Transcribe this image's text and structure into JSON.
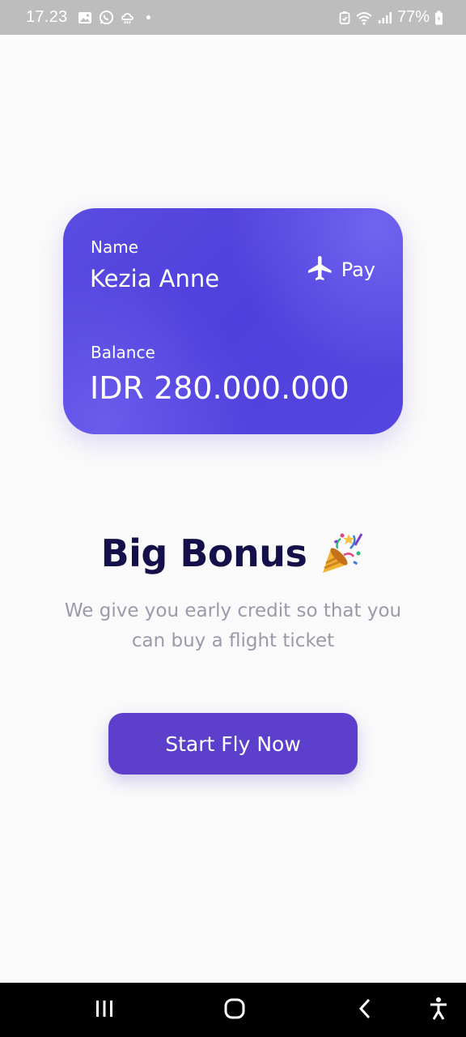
{
  "status_bar": {
    "time": "17.23",
    "battery": "77%",
    "left_icons": [
      "image-icon",
      "whatsapp-icon",
      "weather-icon"
    ],
    "right_icons": [
      "vpn-icon",
      "wifi-icon",
      "signal-icon",
      "battery-icon"
    ]
  },
  "card": {
    "name_label": "Name",
    "name_value": "Kezia Anne",
    "brand_label": "Pay",
    "brand_icon": "airplane-icon",
    "balance_label": "Balance",
    "balance_value": "IDR 280.000.000",
    "gradient_colors": [
      "#5A4BE0",
      "#4F3FDC",
      "#7A6CF5"
    ]
  },
  "headline": {
    "title": "Big Bonus",
    "emoji_icon": "party-popper-icon",
    "title_color": "#14104A"
  },
  "subtitle": "We give you early credit so that you can buy a flight ticket",
  "cta": {
    "label": "Start Fly Now",
    "color": "#5C40CC"
  },
  "nav_bar": {
    "buttons": [
      "recent-apps-icon",
      "home-icon",
      "back-icon",
      "accessibility-icon"
    ]
  }
}
